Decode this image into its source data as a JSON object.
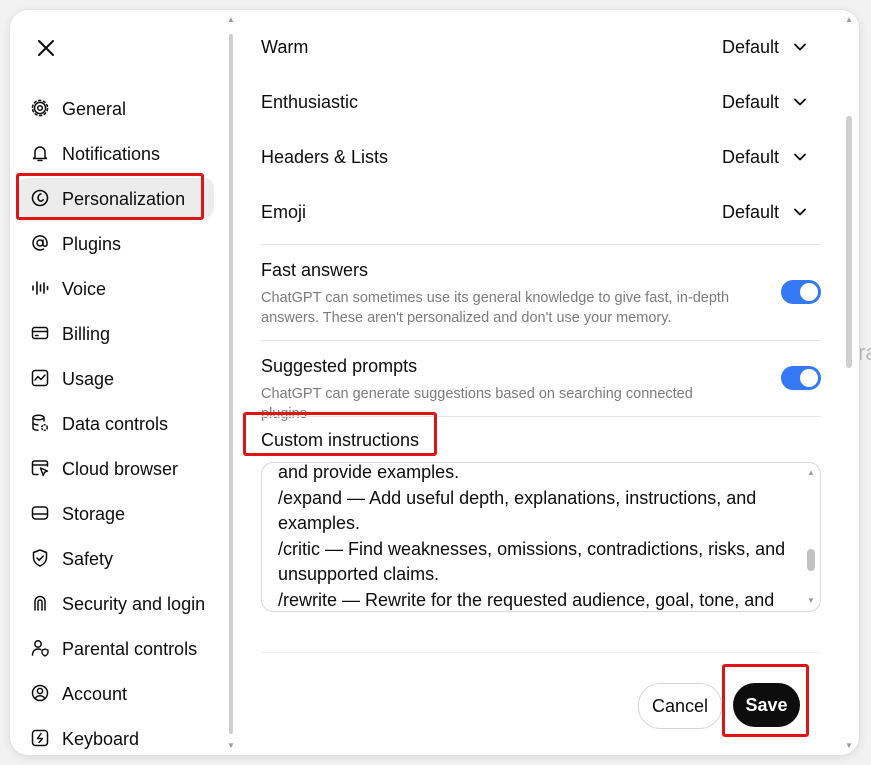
{
  "colors": {
    "accent": "#3478f6",
    "highlight": "#e01414",
    "save_bg": "#0d0d0d"
  },
  "close": {
    "icon": "close-icon"
  },
  "sidebar": {
    "items": [
      {
        "label": "General",
        "icon": "gear-icon",
        "active": false
      },
      {
        "label": "Notifications",
        "icon": "bell-icon",
        "active": false
      },
      {
        "label": "Personalization",
        "icon": "personalization-icon",
        "active": true
      },
      {
        "label": "Plugins",
        "icon": "at-sign-icon",
        "active": false
      },
      {
        "label": "Voice",
        "icon": "waveform-icon",
        "active": false
      },
      {
        "label": "Billing",
        "icon": "credit-card-icon",
        "active": false
      },
      {
        "label": "Usage",
        "icon": "activity-chart-icon",
        "active": false
      },
      {
        "label": "Data controls",
        "icon": "database-gear-icon",
        "active": false
      },
      {
        "label": "Cloud browser",
        "icon": "cursor-browser-icon",
        "active": false
      },
      {
        "label": "Storage",
        "icon": "drive-icon",
        "active": false
      },
      {
        "label": "Safety",
        "icon": "shield-check-icon",
        "active": false
      },
      {
        "label": "Security and login",
        "icon": "fingerprint-icon",
        "active": false
      },
      {
        "label": "Parental controls",
        "icon": "user-shield-icon",
        "active": false
      },
      {
        "label": "Account",
        "icon": "user-circle-icon",
        "active": false
      },
      {
        "label": "Keyboard",
        "icon": "keyboard-icon",
        "active": false
      }
    ]
  },
  "preferences": [
    {
      "label": "Warm",
      "value": "Default"
    },
    {
      "label": "Enthusiastic",
      "value": "Default"
    },
    {
      "label": "Headers & Lists",
      "value": "Default"
    },
    {
      "label": "Emoji",
      "value": "Default"
    }
  ],
  "toggles": [
    {
      "title": "Fast answers",
      "description": "ChatGPT can sometimes use its general knowledge to give fast, in-depth answers. These aren't personalized and don't use your memory.",
      "enabled": true
    },
    {
      "title": "Suggested prompts",
      "description": "ChatGPT can generate suggestions based on searching connected plugins",
      "enabled": true
    }
  ],
  "custom_instructions": {
    "heading": "Custom instructions",
    "value": "and provide examples.\n/expand — Add useful depth, explanations, instructions, and examples.\n/critic — Find weaknesses, omissions, contradictions, risks, and unsupported claims.\n/rewrite — Rewrite for the requested audience, goal, tone, and"
  },
  "footer": {
    "cancel_label": "Cancel",
    "save_label": "Save"
  }
}
